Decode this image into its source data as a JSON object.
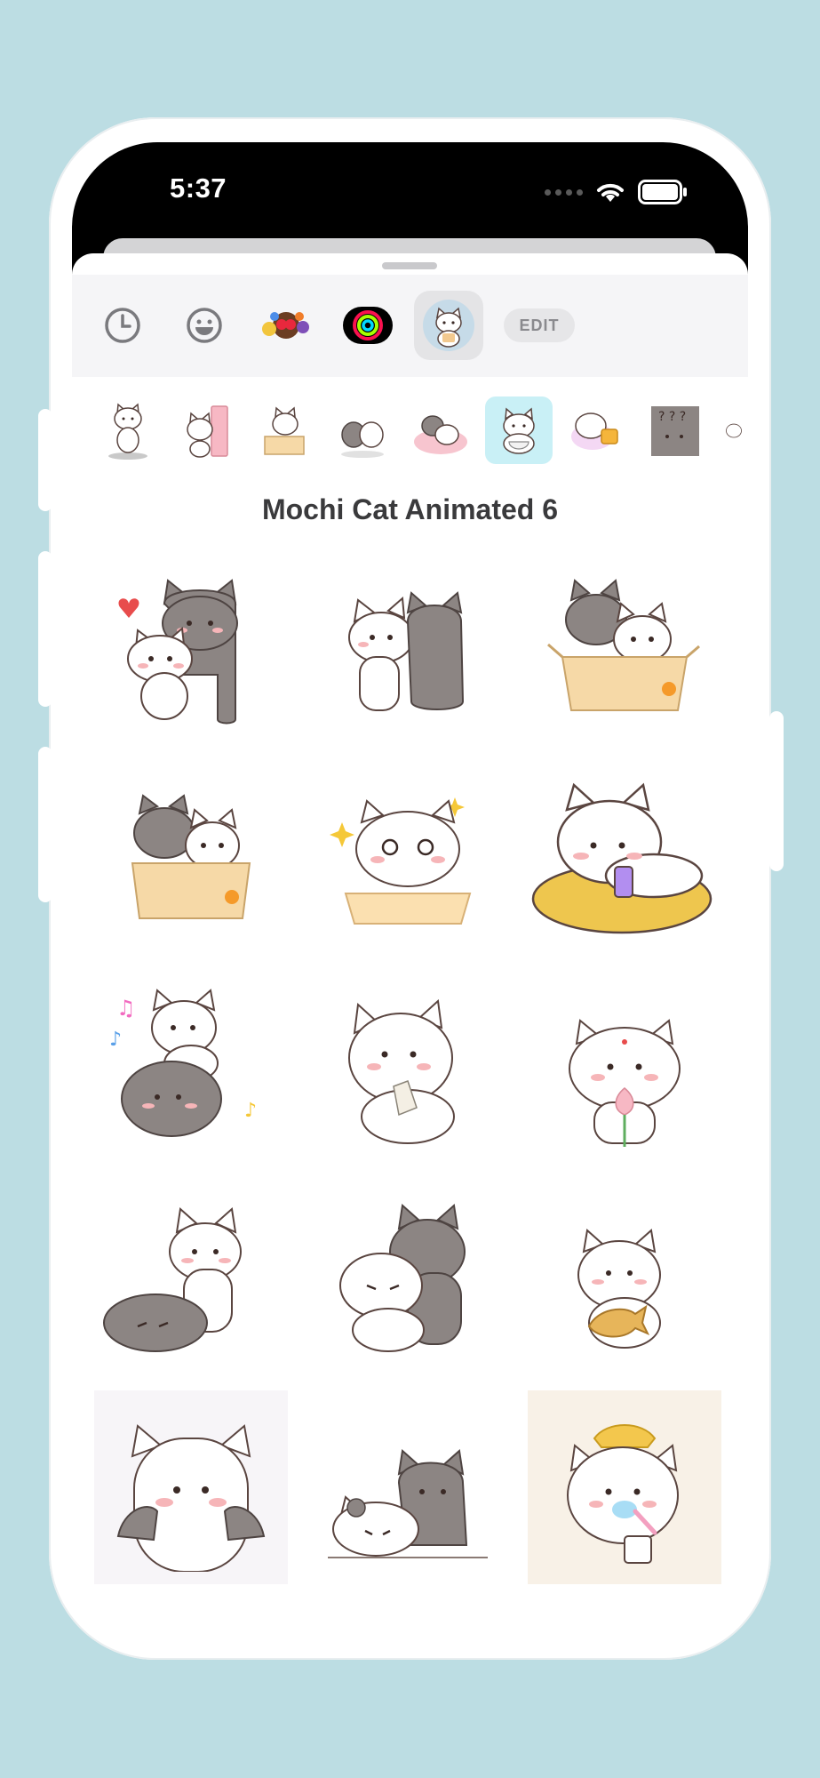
{
  "status_bar": {
    "time": "5:37"
  },
  "tabs": [
    {
      "icon": "recent-clock-icon"
    },
    {
      "icon": "emoji-smiley-icon"
    },
    {
      "icon": "emoji-pack-icon"
    },
    {
      "icon": "activity-rings-icon"
    },
    {
      "icon": "mochi-cat-app-icon"
    }
  ],
  "edit_label": "EDIT",
  "pack_title": "Mochi Cat Animated 6",
  "sticker_names": [
    "mochi-hug-heart-sticker",
    "mochi-kiss-sticker",
    "mochi-box-pair-sticker",
    "mochi-box-peek-sticker",
    "mochi-sparkle-eyes-sticker",
    "mochi-phone-bed-sticker",
    "mochi-music-ride-sticker",
    "mochi-tissue-cry-sticker",
    "mochi-lotus-sticker",
    "mochi-poke-sticker",
    "mochi-cuddle-sticker",
    "mochi-taiyaki-sticker",
    "mochi-cheek-squish-sticker",
    "mochi-sleepy-pair-sticker",
    "mochi-toothbrush-sticker"
  ],
  "colors": {
    "background": "#bcdde3",
    "active_pack": "#c9f0f6",
    "white_cat": "#ffffff",
    "grey_cat": "#8c8583",
    "blush": "#f6b5b8"
  }
}
